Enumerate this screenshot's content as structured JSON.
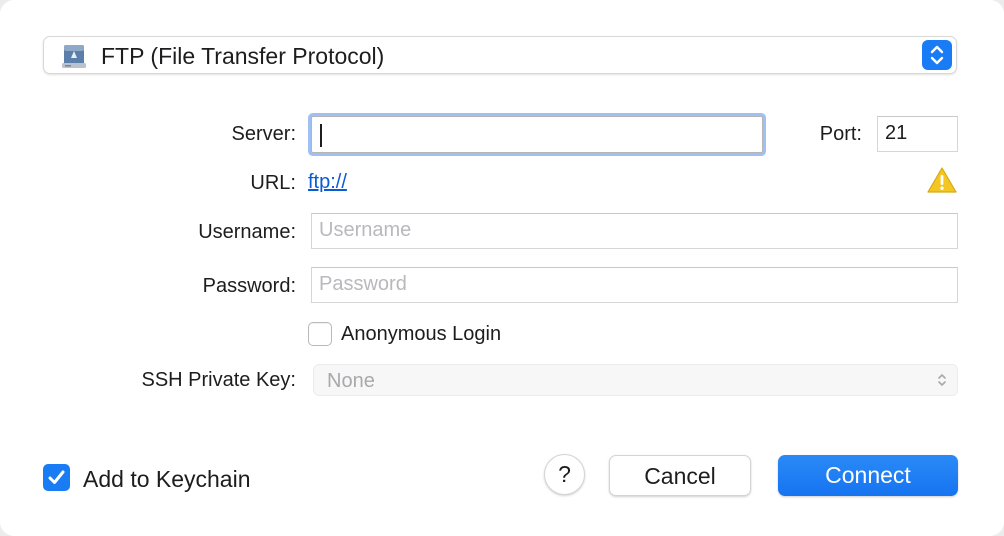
{
  "protocol": {
    "icon": "ftp-server-drive-icon",
    "selected": "FTP (File Transfer Protocol)"
  },
  "form": {
    "server_label": "Server:",
    "server_value": "",
    "port_label": "Port:",
    "port_value": "21",
    "url_label": "URL:",
    "url_value": "ftp://",
    "username_label": "Username:",
    "username_placeholder": "Username",
    "password_label": "Password:",
    "password_placeholder": "Password",
    "anonymous_label": "Anonymous Login",
    "anonymous_checked": false,
    "ssh_label": "SSH Private Key:",
    "ssh_value": "None"
  },
  "footer": {
    "keychain_label": "Add to Keychain",
    "keychain_checked": true,
    "help_label": "?",
    "cancel_label": "Cancel",
    "connect_label": "Connect"
  },
  "colors": {
    "accent": "#1a7cf5",
    "link": "#0a5bd6",
    "warning": "#f3c623"
  }
}
